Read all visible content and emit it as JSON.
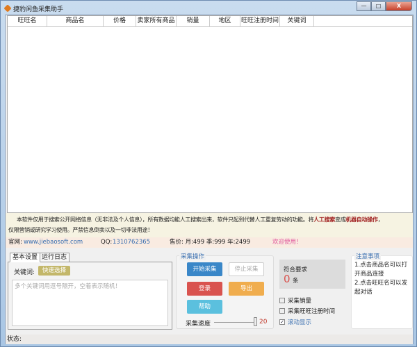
{
  "window": {
    "title": "捷豹闲鱼采集助手",
    "min": "—",
    "max": "□",
    "close": "X"
  },
  "table": {
    "columns": [
      "旺旺名",
      "商品名",
      "价格",
      "卖家所有商品",
      "销量",
      "地区",
      "旺旺注册时间",
      "关键词"
    ]
  },
  "notice": {
    "part1": "本软件仅用于搜索公开网络信息（无非法及个人信息），所有数据均能人工搜索出来，软件只起到代替人工重复劳动的功能。将",
    "red1": "人工搜索",
    "mid": "变成",
    "red2": "机器自动操作",
    "end": "，",
    "line2": "仅限营销或研究学习使用。严禁信息倒卖以及一切非法用途！"
  },
  "info": {
    "site_label": "官网:",
    "site": "www.jiebaosoft.com",
    "qq_label": "QQ:",
    "qq": "1310762365",
    "price": "售价: 月:499  季:999  年:2499",
    "welcome": "欢迎使用！"
  },
  "tabs": [
    "基本设置",
    "运行日志"
  ],
  "settings": {
    "keyword_label": "关键词:",
    "quick_select": "快速选择",
    "keyword_placeholder": "多个关键词用逗号隔开，空着表示随机！"
  },
  "actions": {
    "legend": "采集操作",
    "start": "开始采集",
    "stop": "停止采集",
    "login": "登录",
    "export": "导出",
    "help": "帮助",
    "speed_label": "采集速度",
    "speed": "20"
  },
  "result": {
    "label": "符合要求",
    "count": "0",
    "unit": "条"
  },
  "options": [
    {
      "label": "采集销量",
      "checked": false
    },
    {
      "label": "采集旺旺注册时间",
      "checked": false
    },
    {
      "label": "滚动显示",
      "checked": true
    }
  ],
  "notes": {
    "legend": "注意事项",
    "items": [
      "1.点击商品名可以打开商品连接",
      "2.点击旺旺名可以发起对话"
    ]
  },
  "status": {
    "label": "状态:"
  },
  "colors": {
    "start": "#3a87c8",
    "login": "#d9534f",
    "export": "#f0ad4e",
    "help": "#5bc0de",
    "quick": "#c3b76a"
  }
}
